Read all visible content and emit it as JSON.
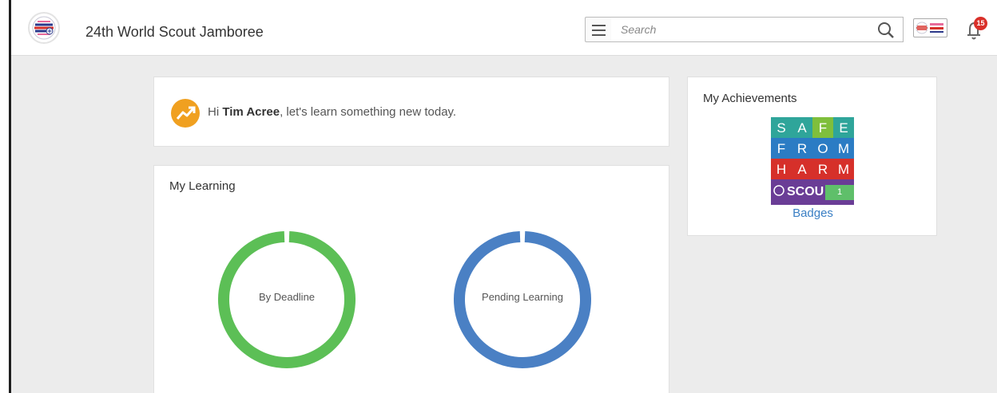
{
  "header": {
    "app_title": "24th World Scout Jamboree",
    "search_placeholder": "Search",
    "notification_count": "15"
  },
  "greeting": {
    "prefix": "Hi ",
    "user_name": "Tim Acree",
    "suffix": ", let's learn something new today."
  },
  "my_learning": {
    "title": "My Learning",
    "donuts": [
      {
        "label": "By Deadline",
        "color": "#5cbf56"
      },
      {
        "label": "Pending Learning",
        "color": "#4a80c4"
      }
    ]
  },
  "achievements": {
    "title": "My Achievements",
    "badge_rows": [
      {
        "letters": [
          "S",
          "A",
          "F",
          "E"
        ],
        "colors": [
          "#2fa59a",
          "#2fa59a",
          "#7fbf3c",
          "#2fa59a"
        ]
      },
      {
        "letters": [
          "F",
          "R",
          "O",
          "M"
        ],
        "colors": [
          "#2b7cc4",
          "#2b7cc4",
          "#2b7cc4",
          "#2b7cc4"
        ]
      },
      {
        "letters": [
          "H",
          "A",
          "R",
          "M"
        ],
        "colors": [
          "#d6302a",
          "#d6302a",
          "#d6302a",
          "#d6302a"
        ]
      }
    ],
    "badge_footer": "SCOU",
    "badge_count": "1",
    "badges_link": "Badges",
    "colors": {
      "purple": "#6a3d96"
    }
  }
}
